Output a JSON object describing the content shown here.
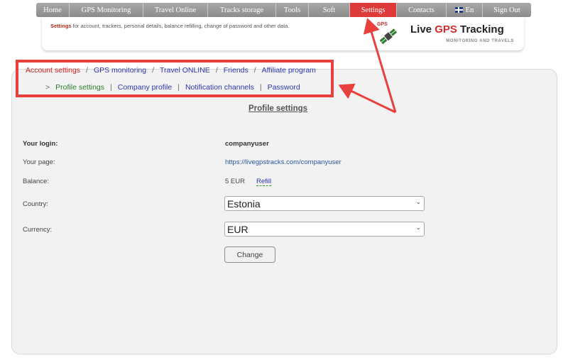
{
  "nav": {
    "items": [
      {
        "label": "Home"
      },
      {
        "label": "GPS Monitoring"
      },
      {
        "label": "Travel Online"
      },
      {
        "label": "Tracks storage"
      },
      {
        "label": "Tools"
      },
      {
        "label": "Soft"
      },
      {
        "label": "Settings"
      },
      {
        "label": "Contacts"
      },
      {
        "label": "En"
      },
      {
        "label": "Sign Out"
      }
    ],
    "active_color": "#de3a3a"
  },
  "header": {
    "desc_bold": "Settings",
    "desc_rest": " for account, trackers, personal details, balance refilling, change of password and other data.",
    "logo_gps_word": "GPS",
    "logo_live": "Live ",
    "logo_gps": "GPS",
    "logo_tracking": " Tracking",
    "logo_sub": "MONITORING AND TRAVELS"
  },
  "breadcrumbs": {
    "row1": [
      "Account settings",
      "GPS monitoring",
      "Travel ONLINE",
      "Friends",
      "Affiliate program"
    ],
    "row2_prefix": ">",
    "row2": [
      "Profile settings",
      "Company profile",
      "Notification channels",
      "Password"
    ],
    "sep": "/",
    "sep2": "|"
  },
  "form": {
    "title": "Profile settings",
    "login_label": "Your login:",
    "login_value": "companyuser",
    "page_label": "Your page:",
    "page_value": "https://livegpstracks.com/companyuser",
    "balance_label": "Balance:",
    "balance_value": "5 EUR",
    "refill_label": "Refill",
    "country_label": "Country:",
    "country_value": "Estonia",
    "currency_label": "Currency:",
    "currency_value": "EUR",
    "change_label": "Change"
  },
  "colors": {
    "annotation": "#e8413d",
    "link": "#2b35b0",
    "active_crumb": "#d42020",
    "current_subcrumb": "#2a7d2a"
  }
}
